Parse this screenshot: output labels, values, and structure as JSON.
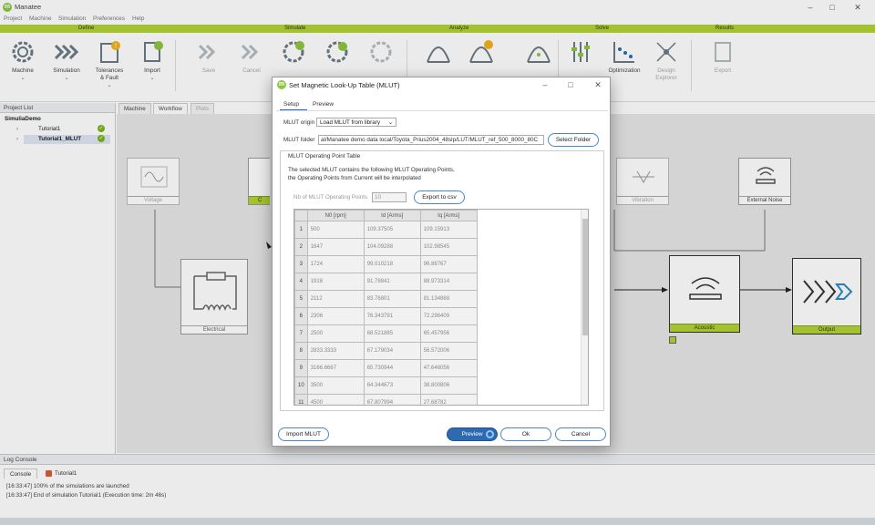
{
  "app": {
    "title": "Manatee",
    "logo_letter": "m"
  },
  "window_controls": {
    "minimize": "–",
    "maximize": "□",
    "close": "✕"
  },
  "menu": [
    "Project",
    "Machine",
    "Simulation",
    "Preferences",
    "Help"
  ],
  "sections": [
    "Define",
    "Simulate",
    "Analyze",
    "Solve",
    "Results"
  ],
  "toolbar": {
    "machine": "Machine",
    "simulation": "Simulation",
    "tolerances": "Tolerances\n& Fault",
    "import": "Import",
    "save": "Save",
    "cancel": "Cancel",
    "optimization": "Optimization",
    "design_explorer": "Design\nExplorer",
    "export": "Export",
    "chevron": "⌄"
  },
  "project_list": {
    "title": "Project List",
    "root": "SimuliaDemo",
    "items": [
      "Tutorial1",
      "Tutorial1_MLUT"
    ]
  },
  "tabs": [
    "Machine",
    "Workflow",
    "Plots"
  ],
  "workflow_blocks": {
    "voltage": "Voltage",
    "electrical": "Electrical",
    "vibration": "Vibration",
    "external_noise": "External Noise",
    "acoustic": "Acoustic",
    "output": "Output",
    "partial": "C"
  },
  "log_console": {
    "title": "Log Console",
    "tabs": [
      "Console",
      "Tutorial1"
    ],
    "lines": [
      "[16:33:47] 100% of the simulations are launched",
      "[16:33:47] End of simulation Tutorial1 (Execution time: 2m 46s)"
    ]
  },
  "dialog": {
    "title": "Set Magnetic Look-Up Table (MLUT)",
    "tabs": [
      "Setup",
      "Preview"
    ],
    "mlut_origin_label": "MLUT origin",
    "mlut_origin_value": "Load MLUT from library",
    "mlut_folder_label": "MLUT folder",
    "mlut_folder_value": "al/Manatee demo data local/Toyota_Prius2004_48slp/LUT/MLUT_ref_500_8000_80C",
    "select_folder": "Select Folder",
    "group_title": "MLUT Operating Point Table",
    "info_line1": "The selected MLUT contains the following MLUT Operating Points,",
    "info_line2": "the Operating Points from Current will be interpolated",
    "nb_label": "Nb of MLUT Operating Points",
    "nb_value": "10",
    "export_csv": "Export to csv",
    "columns": [
      "N0 [rpm]",
      "Id [Arms]",
      "Iq [Arms]"
    ],
    "rows": [
      [
        "1",
        "500",
        "109.37505",
        "109.15913"
      ],
      [
        "2",
        "1647",
        "104.09288",
        "102.98545"
      ],
      [
        "3",
        "1724",
        "99.010218",
        "96.88767"
      ],
      [
        "4",
        "1918",
        "91.78841",
        "88.973314"
      ],
      [
        "5",
        "2112",
        "83.76801",
        "81.134868"
      ],
      [
        "6",
        "2306",
        "76.343791",
        "72.296409"
      ],
      [
        "7",
        "2500",
        "68.521885",
        "65.457956"
      ],
      [
        "8",
        "2833.3333",
        "67.179034",
        "56.572006"
      ],
      [
        "9",
        "3166.6667",
        "65.730944",
        "47.646056"
      ],
      [
        "10",
        "3500",
        "64.344673",
        "38.800806"
      ],
      [
        "11",
        "4500",
        "67.807994",
        "27.68782"
      ]
    ],
    "import_mlut": "Import MLUT",
    "preview": "Preview",
    "ok": "Ok",
    "cancel": "Cancel"
  },
  "colors": {
    "accent_green": "#b2d234",
    "primary_blue": "#2d6ab2",
    "ok_green": "#7cb518"
  }
}
